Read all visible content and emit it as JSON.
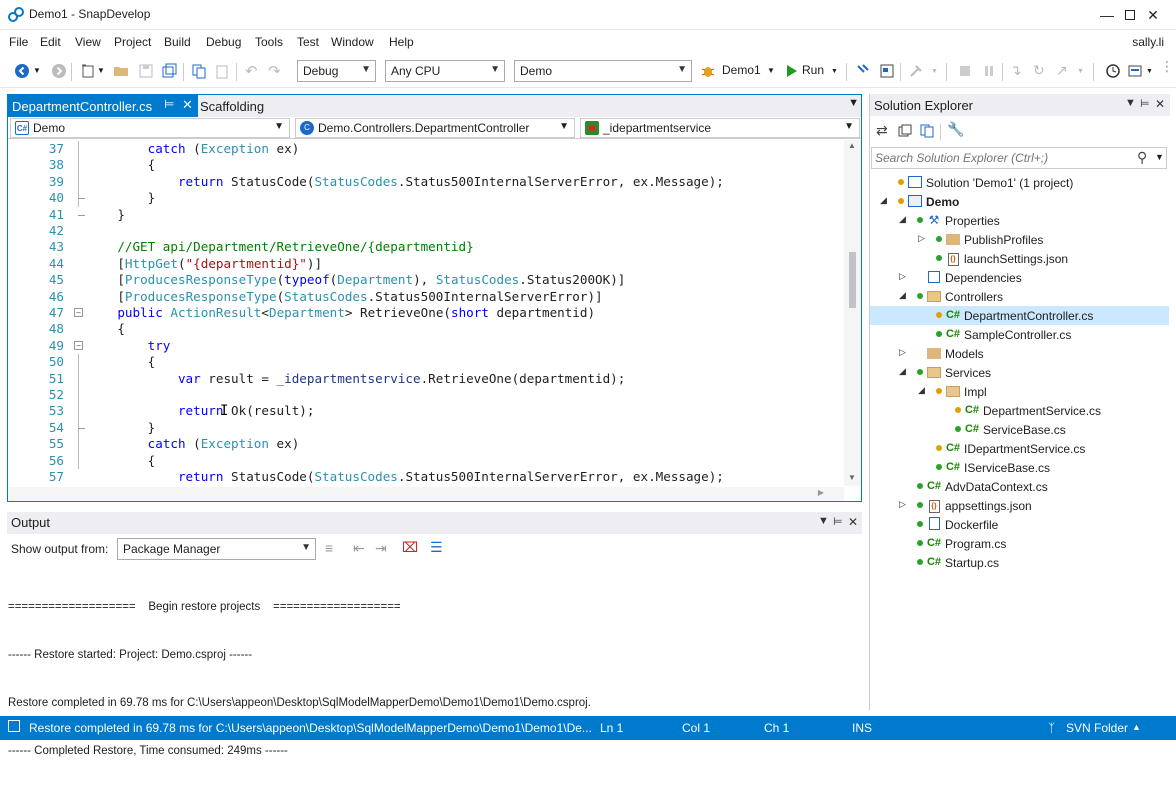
{
  "window": {
    "title": "Demo1 - SnapDevelop",
    "controls": [
      "minimize",
      "maximize",
      "close"
    ]
  },
  "menu": {
    "items": [
      "File",
      "Edit",
      "View",
      "Project",
      "Build",
      "Debug",
      "Tools",
      "Test",
      "Window",
      "Help"
    ],
    "user": "sally.li"
  },
  "toolbar": {
    "config": "Debug",
    "platform": "Any CPU",
    "project": "Demo",
    "startup": "Demo1",
    "run_label": "Run"
  },
  "editor": {
    "tabs": [
      {
        "label": "DepartmentController.cs",
        "active": true
      },
      {
        "label": "Scaffolding",
        "active": false
      }
    ],
    "nav": {
      "project": "Demo",
      "class": "Demo.Controllers.DepartmentController",
      "member": "_idepartmentservice"
    },
    "lines": [
      {
        "n": "37",
        "indent": 8,
        "tokens": [
          [
            "kw",
            "catch"
          ],
          [
            "t",
            " ("
          ],
          [
            "ty",
            "Exception"
          ],
          [
            "t",
            " ex)"
          ]
        ]
      },
      {
        "n": "38",
        "indent": 8,
        "tokens": [
          [
            "t",
            "{"
          ]
        ]
      },
      {
        "n": "39",
        "indent": 12,
        "tokens": [
          [
            "kw",
            "return"
          ],
          [
            "t",
            " StatusCode("
          ],
          [
            "ty",
            "StatusCodes"
          ],
          [
            "t",
            ".Status500InternalServerError, ex.Message);"
          ]
        ]
      },
      {
        "n": "40",
        "indent": 8,
        "tokens": [
          [
            "t",
            "}"
          ]
        ]
      },
      {
        "n": "41",
        "indent": 4,
        "tokens": [
          [
            "t",
            "}"
          ]
        ]
      },
      {
        "n": "42",
        "indent": 0,
        "tokens": []
      },
      {
        "n": "43",
        "indent": 4,
        "tokens": [
          [
            "cm",
            "//GET api/Department/RetrieveOne/{departmentid}"
          ]
        ]
      },
      {
        "n": "44",
        "indent": 4,
        "tokens": [
          [
            "t",
            "["
          ],
          [
            "ty",
            "HttpGet"
          ],
          [
            "t",
            "("
          ],
          [
            "st",
            "\"{departmentid}\""
          ],
          [
            "t",
            ")]"
          ]
        ]
      },
      {
        "n": "45",
        "indent": 4,
        "tokens": [
          [
            "t",
            "["
          ],
          [
            "ty",
            "ProducesResponseType"
          ],
          [
            "t",
            "("
          ],
          [
            "kw",
            "typeof"
          ],
          [
            "t",
            "("
          ],
          [
            "ty",
            "Department"
          ],
          [
            "t",
            "), "
          ],
          [
            "ty",
            "StatusCodes"
          ],
          [
            "t",
            ".Status200OK)]"
          ]
        ]
      },
      {
        "n": "46",
        "indent": 4,
        "tokens": [
          [
            "t",
            "["
          ],
          [
            "ty",
            "ProducesResponseType"
          ],
          [
            "t",
            "("
          ],
          [
            "ty",
            "StatusCodes"
          ],
          [
            "t",
            ".Status500InternalServerError)]"
          ]
        ]
      },
      {
        "n": "47",
        "indent": 4,
        "tokens": [
          [
            "kw",
            "public"
          ],
          [
            "t",
            " "
          ],
          [
            "ty",
            "ActionResult"
          ],
          [
            "t",
            "<"
          ],
          [
            "ty",
            "Department"
          ],
          [
            "t",
            "> RetrieveOne("
          ],
          [
            "kw",
            "short"
          ],
          [
            "t",
            " departmentid)"
          ]
        ]
      },
      {
        "n": "48",
        "indent": 4,
        "tokens": [
          [
            "t",
            "{"
          ]
        ]
      },
      {
        "n": "49",
        "indent": 8,
        "tokens": [
          [
            "kw",
            "try"
          ]
        ]
      },
      {
        "n": "50",
        "indent": 8,
        "tokens": [
          [
            "t",
            "{"
          ]
        ]
      },
      {
        "n": "51",
        "indent": 12,
        "tokens": [
          [
            "kw",
            "var"
          ],
          [
            "t",
            " result = "
          ],
          [
            "fd",
            "_idepartmentservice"
          ],
          [
            "t",
            ".RetrieveOne(departmentid);"
          ]
        ]
      },
      {
        "n": "52",
        "indent": 0,
        "tokens": []
      },
      {
        "n": "53",
        "indent": 12,
        "tokens": [
          [
            "kw",
            "return"
          ],
          [
            "t",
            " Ok(result);"
          ]
        ]
      },
      {
        "n": "54",
        "indent": 8,
        "tokens": [
          [
            "t",
            "}"
          ]
        ]
      },
      {
        "n": "55",
        "indent": 8,
        "tokens": [
          [
            "kw",
            "catch"
          ],
          [
            "t",
            " ("
          ],
          [
            "ty",
            "Exception"
          ],
          [
            "t",
            " ex)"
          ]
        ]
      },
      {
        "n": "56",
        "indent": 8,
        "tokens": [
          [
            "t",
            "{"
          ]
        ]
      },
      {
        "n": "57",
        "indent": 12,
        "tokens": [
          [
            "kw",
            "return"
          ],
          [
            "t",
            " StatusCode("
          ],
          [
            "ty",
            "StatusCodes"
          ],
          [
            "t",
            ".Status500InternalServerError, ex.Message);"
          ]
        ]
      }
    ]
  },
  "output": {
    "title": "Output",
    "show_from_label": "Show output from:",
    "source": "Package Manager",
    "lines": [
      "===================    Begin restore projects    ===================",
      "------ Restore started: Project: Demo.csproj ------",
      "Restore completed in 69.78 ms for C:\\Users\\appeon\\Desktop\\SqlModelMapperDemo\\Demo1\\Demo1\\Demo.csproj.",
      "------ Completed Restore, Time consumed: 249ms ------"
    ]
  },
  "solution_explorer": {
    "title": "Solution Explorer",
    "search_placeholder": "Search Solution Explorer (Ctrl+;)",
    "tree": [
      {
        "label": "Solution 'Demo1' (1 project)",
        "level": 0,
        "expander": "",
        "icon": "solution-icon",
        "dot": "#e0a000",
        "bold": false,
        "selected": false
      },
      {
        "label": "Demo",
        "level": 0,
        "expander": "down",
        "icon": "project-icon",
        "dot": "#e0a000",
        "bold": true,
        "selected": false
      },
      {
        "label": "Properties",
        "level": 1,
        "expander": "down",
        "icon": "wrench-icon",
        "dot": "#2aa32a",
        "bold": false,
        "selected": false
      },
      {
        "label": "PublishProfiles",
        "level": 2,
        "expander": "right",
        "icon": "folder-icon",
        "dot": "#2aa32a",
        "bold": false,
        "selected": false
      },
      {
        "label": "launchSettings.json",
        "level": 2,
        "expander": "",
        "icon": "json-icon",
        "dot": "#2aa32a",
        "bold": false,
        "selected": false
      },
      {
        "label": "Dependencies",
        "level": 1,
        "expander": "right",
        "icon": "dependencies-icon",
        "dot": "",
        "bold": false,
        "selected": false
      },
      {
        "label": "Controllers",
        "level": 1,
        "expander": "down",
        "icon": "open-folder-icon",
        "dot": "#2aa32a",
        "bold": false,
        "selected": false
      },
      {
        "label": "DepartmentController.cs",
        "level": 2,
        "expander": "",
        "icon": "csharp-file-icon",
        "dot": "#e0a000",
        "bold": false,
        "selected": true
      },
      {
        "label": "SampleController.cs",
        "level": 2,
        "expander": "",
        "icon": "csharp-file-icon",
        "dot": "#2aa32a",
        "bold": false,
        "selected": false
      },
      {
        "label": "Models",
        "level": 1,
        "expander": "right",
        "icon": "folder-icon",
        "dot": "",
        "bold": false,
        "selected": false
      },
      {
        "label": "Services",
        "level": 1,
        "expander": "down",
        "icon": "open-folder-icon",
        "dot": "#2aa32a",
        "bold": false,
        "selected": false
      },
      {
        "label": "Impl",
        "level": 2,
        "expander": "down",
        "icon": "open-folder-icon",
        "dot": "#e0a000",
        "bold": false,
        "selected": false
      },
      {
        "label": "DepartmentService.cs",
        "level": 3,
        "expander": "",
        "icon": "csharp-file-icon",
        "dot": "#e0a000",
        "bold": false,
        "selected": false
      },
      {
        "label": "ServiceBase.cs",
        "level": 3,
        "expander": "",
        "icon": "csharp-file-icon",
        "dot": "#2aa32a",
        "bold": false,
        "selected": false
      },
      {
        "label": "IDepartmentService.cs",
        "level": 2,
        "expander": "",
        "icon": "csharp-file-icon",
        "dot": "#e0a000",
        "bold": false,
        "selected": false
      },
      {
        "label": "IServiceBase.cs",
        "level": 2,
        "expander": "",
        "icon": "csharp-file-icon",
        "dot": "#2aa32a",
        "bold": false,
        "selected": false
      },
      {
        "label": "AdvDataContext.cs",
        "level": 1,
        "expander": "",
        "icon": "csharp-file-icon",
        "dot": "#2aa32a",
        "bold": false,
        "selected": false
      },
      {
        "label": "appsettings.json",
        "level": 1,
        "expander": "right",
        "icon": "json-icon",
        "dot": "#2aa32a",
        "bold": false,
        "selected": false
      },
      {
        "label": "Dockerfile",
        "level": 1,
        "expander": "",
        "icon": "file-icon",
        "dot": "#2aa32a",
        "bold": false,
        "selected": false
      },
      {
        "label": "Program.cs",
        "level": 1,
        "expander": "",
        "icon": "csharp-file-icon",
        "dot": "#2aa32a",
        "bold": false,
        "selected": false
      },
      {
        "label": "Startup.cs",
        "level": 1,
        "expander": "",
        "icon": "csharp-file-icon",
        "dot": "#2aa32a",
        "bold": false,
        "selected": false
      }
    ]
  },
  "status": {
    "message": "Restore completed in 69.78 ms for C:\\Users\\appeon\\Desktop\\SqlModelMapperDemo\\Demo1\\Demo1\\De...",
    "line": "Ln 1",
    "col": "Col 1",
    "ch": "Ch 1",
    "mode": "INS",
    "svn": "SVN Folder"
  },
  "colors": {
    "accent": "#007acc",
    "panel_header": "#eeeef2",
    "selection": "#cce8ff"
  }
}
